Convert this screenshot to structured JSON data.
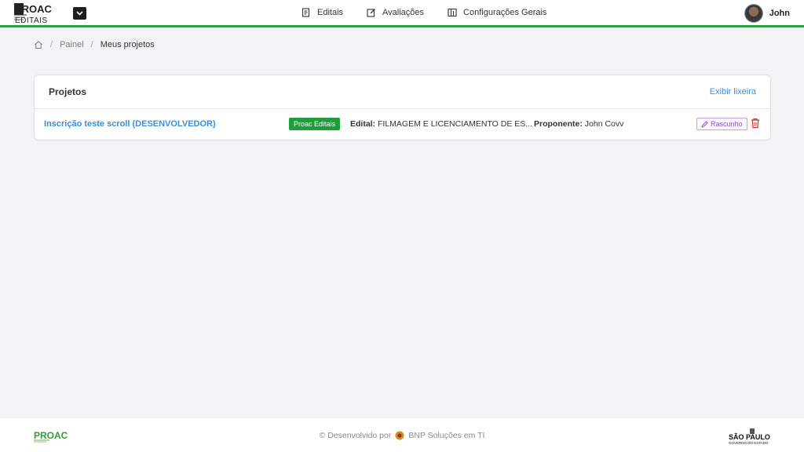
{
  "header": {
    "logo": {
      "line1": "PROAC",
      "line2": "EDITAIS"
    },
    "nav": [
      {
        "label": "Editais",
        "icon": "document-icon"
      },
      {
        "label": "Avaliações",
        "icon": "edit-icon"
      },
      {
        "label": "Configurações Gerais",
        "icon": "settings-table-icon"
      }
    ],
    "user": {
      "name": "John"
    }
  },
  "breadcrumb": {
    "items": [
      "Painel",
      "Meus projetos"
    ],
    "separator": "/"
  },
  "projects_card": {
    "title": "Projetos",
    "trash_link": "Exibir lixeira",
    "rows": [
      {
        "name": "Inscrição teste scroll (DESENVOLVEDOR)",
        "badge": "Proac Editais",
        "edital_label": "Edital:",
        "edital_value": "FILMAGEM E LICENCIAMENTO DE ES...",
        "proponente_label": "Proponente:",
        "proponente_value": "John Covv",
        "status": "Rascunho"
      }
    ]
  },
  "footer": {
    "logo_text": "PROAC",
    "credit_prefix": "© Desenvolvido por",
    "credit_company": "BNP Soluções em TI",
    "gov_logo": {
      "line1": "SÃO PAULO",
      "line2": "GOVERNO DO ESTADO"
    }
  },
  "colors": {
    "accent_green": "#2e9e3e",
    "link_blue": "#3b8fd8",
    "badge_green": "#1e9e3a",
    "status_purple": "#8a4fbf",
    "delete_red": "#d9342b"
  }
}
